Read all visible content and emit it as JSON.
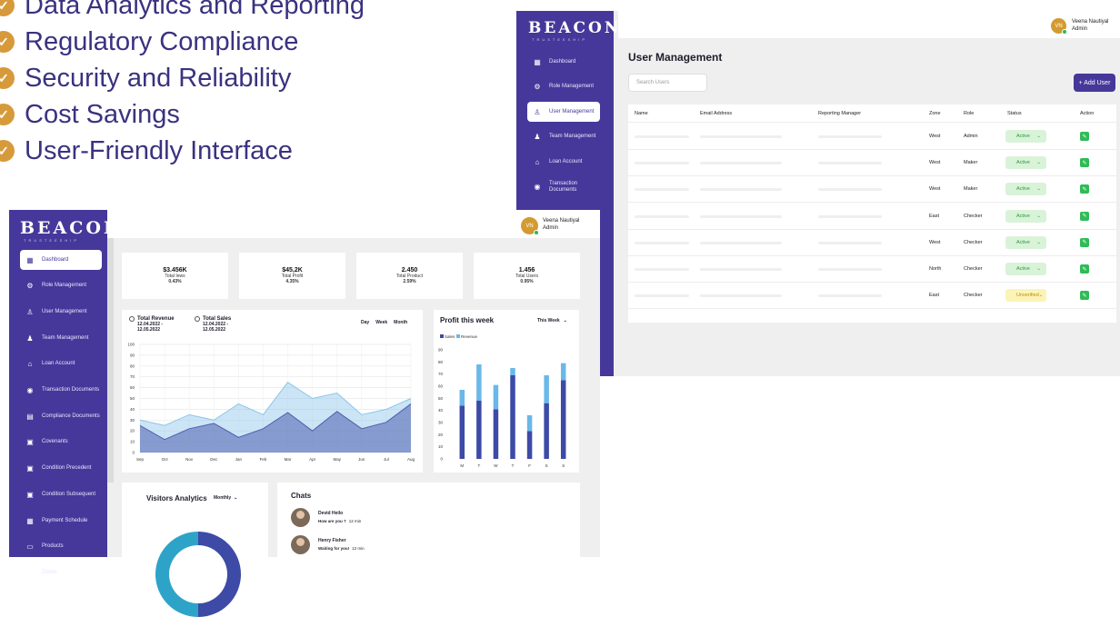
{
  "features": [
    {
      "label": "Data Analytics and Reporting"
    },
    {
      "label": "Regulatory Compliance"
    },
    {
      "label": "Security and Reliability"
    },
    {
      "label": "Cost Savings"
    },
    {
      "label": "User-Friendly Interface"
    }
  ],
  "brand": {
    "logo": "BEACON",
    "tagline": "TRUSTEESHIP"
  },
  "user": {
    "initials": "VN",
    "name": "Veena Nautiyal",
    "role": "Admin"
  },
  "um": {
    "sidebar": [
      {
        "label": "Dashboard",
        "icon": "grid-icon"
      },
      {
        "label": "Role Management",
        "icon": "role-icon"
      },
      {
        "label": "User Management",
        "icon": "user-icon",
        "active": true
      },
      {
        "label": "Team Management",
        "icon": "team-icon"
      },
      {
        "label": "Loan Account",
        "icon": "bank-icon"
      },
      {
        "label": "Transaction Documents",
        "icon": "money-icon"
      }
    ],
    "title": "User Management",
    "search_placeholder": "Search Users",
    "add_button": "+ Add User",
    "columns": [
      "Name",
      "Email Address",
      "Reporting Manager",
      "Zone",
      "Role",
      "Status",
      "Action"
    ],
    "rows": [
      {
        "zone": "West",
        "role": "Admin",
        "status": "Active"
      },
      {
        "zone": "West",
        "role": "Maker",
        "status": "Active"
      },
      {
        "zone": "West",
        "role": "Maker",
        "status": "Active"
      },
      {
        "zone": "East",
        "role": "Checker",
        "status": "Active"
      },
      {
        "zone": "West",
        "role": "Checker",
        "status": "Active"
      },
      {
        "zone": "North",
        "role": "Checker",
        "status": "Active"
      },
      {
        "zone": "East",
        "role": "Checker",
        "status": "Unverified"
      }
    ]
  },
  "db": {
    "sidebar": [
      {
        "label": "Dashboard",
        "icon": "grid-icon",
        "active": true
      },
      {
        "label": "Role Management",
        "icon": "role-icon"
      },
      {
        "label": "User Management",
        "icon": "user-icon"
      },
      {
        "label": "Team Management",
        "icon": "team-icon"
      },
      {
        "label": "Loan Account",
        "icon": "bank-icon"
      },
      {
        "label": "Transaction Documents",
        "icon": "money-icon"
      },
      {
        "label": "Compliance Documents",
        "icon": "doc-icon"
      },
      {
        "label": "Covenants",
        "icon": "file-icon"
      },
      {
        "label": "Condition Precedent",
        "icon": "file-icon"
      },
      {
        "label": "Condition Subsequent",
        "icon": "file-icon"
      },
      {
        "label": "Payment Schedule",
        "icon": "calendar-icon"
      },
      {
        "label": "Products",
        "icon": "box-icon"
      },
      {
        "label": "Zones",
        "icon": "pin-icon"
      }
    ],
    "stats": [
      {
        "value": "$3.456K",
        "label": "Total Iews",
        "pct": "0.43%"
      },
      {
        "value": "$45,2K",
        "label": "Total Profit",
        "pct": "4.35%"
      },
      {
        "value": "2.450",
        "label": "Total Product",
        "pct": "2.59%"
      },
      {
        "value": "1.456",
        "label": "Total Users",
        "pct": "0.95%"
      }
    ],
    "revenue_card": {
      "legend": [
        {
          "label": "Total Revenue",
          "range": "12.04.2022 - 12.05.2022"
        },
        {
          "label": "Total Sales",
          "range": "12.04.2022 - 12.05.2022"
        }
      ],
      "tabs": [
        "Day",
        "Week",
        "Month"
      ]
    },
    "profit_card": {
      "title": "Profit this week",
      "period": "This Week"
    },
    "visitors_card": {
      "title": "Visitors Analytics",
      "period": "Monthly"
    },
    "chats": {
      "title": "Chats",
      "items": [
        {
          "name": "Devid Heilo",
          "message": "How are you ?",
          "time": "12 min"
        },
        {
          "name": "Henry Fisher",
          "message": "Waiting for you!",
          "time": "12 min"
        }
      ]
    }
  },
  "chart_data": [
    {
      "type": "area",
      "categories": [
        "Sep",
        "Oct",
        "Nov",
        "Dec",
        "Jan",
        "Feb",
        "Mar",
        "Apr",
        "May",
        "Jun",
        "Jul",
        "Aug"
      ],
      "series": [
        {
          "name": "Total Revenue",
          "values": [
            30,
            25,
            35,
            30,
            45,
            35,
            65,
            50,
            55,
            35,
            40,
            50
          ],
          "color": "#8cc6ea"
        },
        {
          "name": "Total Sales",
          "values": [
            25,
            12,
            22,
            27,
            14,
            22,
            37,
            20,
            38,
            22,
            28,
            45
          ],
          "color": "#4f5fae"
        }
      ],
      "ylim": [
        0,
        100
      ],
      "yticks": [
        0,
        10,
        20,
        30,
        40,
        50,
        60,
        70,
        80,
        90,
        100
      ],
      "grid": true
    },
    {
      "type": "bar",
      "title": "Profit this week",
      "categories": [
        "M",
        "T",
        "W",
        "T",
        "F",
        "S",
        "S"
      ],
      "series": [
        {
          "name": "Sales",
          "values": [
            44,
            48,
            41,
            69,
            23,
            46,
            65
          ],
          "color": "#3d4aa6"
        },
        {
          "name": "Revenue",
          "values": [
            13,
            30,
            20,
            6,
            13,
            23,
            14
          ],
          "color": "#6ab8e8"
        }
      ],
      "stacked": true,
      "ylim": [
        0,
        90
      ],
      "yticks": [
        0,
        10,
        20,
        30,
        40,
        50,
        60,
        70,
        80,
        90
      ],
      "legend_position": "top-left"
    }
  ]
}
